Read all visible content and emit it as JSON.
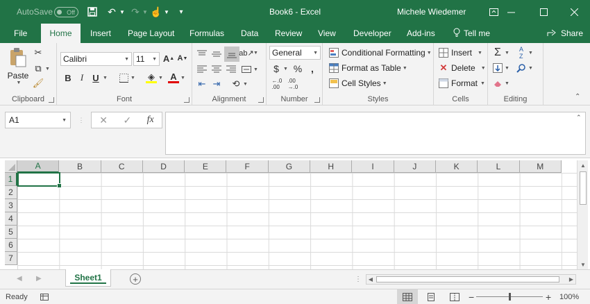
{
  "titlebar": {
    "autosave_label": "AutoSave",
    "autosave_state": "Off",
    "doc_title": "Book6  -  Excel",
    "user_name": "Michele Wiedemer",
    "colors": {
      "brand": "#217346"
    }
  },
  "tabs": [
    {
      "label": "File"
    },
    {
      "label": "Home"
    },
    {
      "label": "Insert"
    },
    {
      "label": "Page Layout"
    },
    {
      "label": "Formulas"
    },
    {
      "label": "Data"
    },
    {
      "label": "Review"
    },
    {
      "label": "View"
    },
    {
      "label": "Developer"
    },
    {
      "label": "Add-ins"
    },
    {
      "label": "Tell me"
    }
  ],
  "share_label": "Share",
  "ribbon": {
    "clipboard": {
      "label": "Clipboard",
      "paste_label": "Paste"
    },
    "font": {
      "label": "Font",
      "font_name": "Calibri",
      "font_size": "11"
    },
    "alignment": {
      "label": "Alignment"
    },
    "number": {
      "label": "Number",
      "format": "General"
    },
    "styles": {
      "label": "Styles",
      "conditional_formatting": "Conditional Formatting",
      "format_as_table": "Format as Table",
      "cell_styles": "Cell Styles"
    },
    "cells": {
      "label": "Cells",
      "insert": "Insert",
      "delete": "Delete",
      "format": "Format"
    },
    "editing": {
      "label": "Editing"
    }
  },
  "formula_bar": {
    "name_box": "A1",
    "value": ""
  },
  "grid": {
    "columns": [
      "A",
      "B",
      "C",
      "D",
      "E",
      "F",
      "G",
      "H",
      "I",
      "J",
      "K",
      "L",
      "M"
    ],
    "rows": [
      "1",
      "2",
      "3",
      "4",
      "5",
      "6",
      "7"
    ],
    "active_cell": "A1"
  },
  "sheets": [
    {
      "name": "Sheet1",
      "active": true
    }
  ],
  "statusbar": {
    "status": "Ready",
    "zoom": "100%"
  }
}
